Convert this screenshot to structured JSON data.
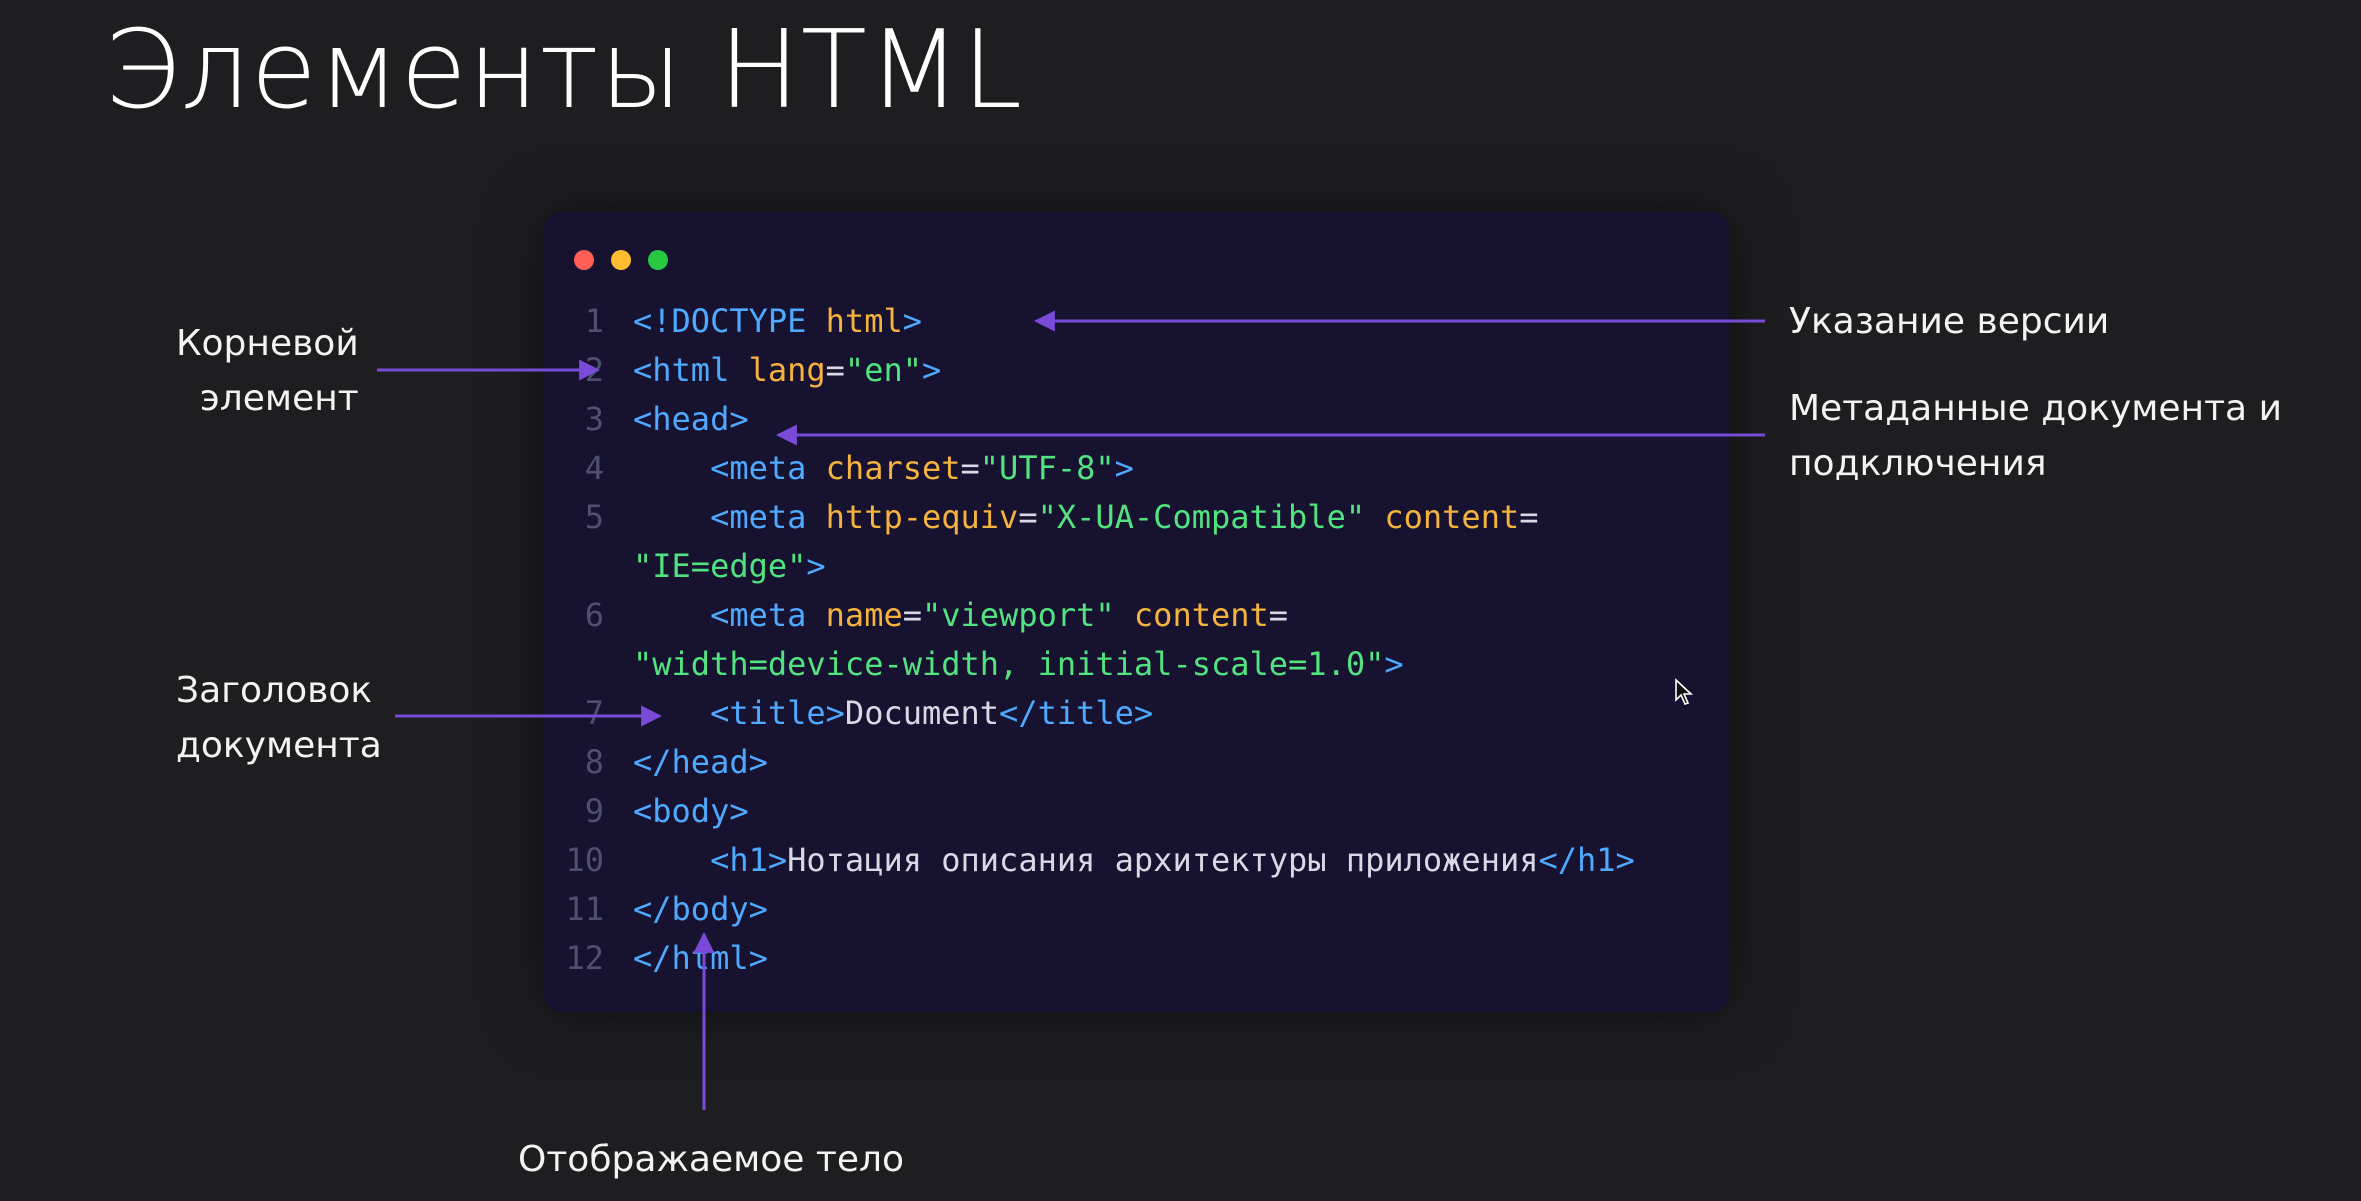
{
  "slide": {
    "title": "Элементы HTML"
  },
  "colors": {
    "background": "#1e1e21",
    "window": "#16122f",
    "tag": "#4fa9ff",
    "attribute": "#f4b23e",
    "string": "#52e27f",
    "text": "#d9d9e6",
    "line_number": "#4f4f6e",
    "arrow": "#7a4ad8",
    "dot_red": "#ff5f57",
    "dot_yellow": "#febc2e",
    "dot_green": "#28c840"
  },
  "code": {
    "lines": [
      {
        "num": "1",
        "tokens": [
          {
            "t": "tag",
            "v": "<!DOCTYPE "
          },
          {
            "t": "attr",
            "v": "html"
          },
          {
            "t": "tag",
            "v": ">"
          }
        ]
      },
      {
        "num": "2",
        "tokens": [
          {
            "t": "tag",
            "v": "<html "
          },
          {
            "t": "attr",
            "v": "lang"
          },
          {
            "t": "plain",
            "v": "="
          },
          {
            "t": "str",
            "v": "\"en\""
          },
          {
            "t": "tag",
            "v": ">"
          }
        ]
      },
      {
        "num": "3",
        "tokens": [
          {
            "t": "tag",
            "v": "<head>"
          }
        ]
      },
      {
        "num": "4",
        "tokens": [
          {
            "t": "plain",
            "v": "    "
          },
          {
            "t": "tag",
            "v": "<meta "
          },
          {
            "t": "attr",
            "v": "charset"
          },
          {
            "t": "plain",
            "v": "="
          },
          {
            "t": "str",
            "v": "\"UTF-8\""
          },
          {
            "t": "tag",
            "v": ">"
          }
        ]
      },
      {
        "num": "5",
        "tokens": [
          {
            "t": "plain",
            "v": "    "
          },
          {
            "t": "tag",
            "v": "<meta "
          },
          {
            "t": "attr",
            "v": "http-equiv"
          },
          {
            "t": "plain",
            "v": "="
          },
          {
            "t": "str",
            "v": "\"X-UA-Compatible\""
          },
          {
            "t": "plain",
            "v": " "
          },
          {
            "t": "attr",
            "v": "content"
          },
          {
            "t": "plain",
            "v": "="
          }
        ]
      },
      {
        "num": "",
        "tokens": [
          {
            "t": "str",
            "v": "\"IE=edge\""
          },
          {
            "t": "tag",
            "v": ">"
          }
        ]
      },
      {
        "num": "6",
        "tokens": [
          {
            "t": "plain",
            "v": "    "
          },
          {
            "t": "tag",
            "v": "<meta "
          },
          {
            "t": "attr",
            "v": "name"
          },
          {
            "t": "plain",
            "v": "="
          },
          {
            "t": "str",
            "v": "\"viewport\""
          },
          {
            "t": "plain",
            "v": " "
          },
          {
            "t": "attr",
            "v": "content"
          },
          {
            "t": "plain",
            "v": "="
          }
        ]
      },
      {
        "num": "",
        "tokens": [
          {
            "t": "str",
            "v": "\"width=device-width, initial-scale=1.0\""
          },
          {
            "t": "tag",
            "v": ">"
          }
        ]
      },
      {
        "num": "7",
        "tokens": [
          {
            "t": "plain",
            "v": "    "
          },
          {
            "t": "tag",
            "v": "<title>"
          },
          {
            "t": "plain",
            "v": "Document"
          },
          {
            "t": "tag",
            "v": "</title>"
          }
        ]
      },
      {
        "num": "8",
        "tokens": [
          {
            "t": "tag",
            "v": "</head>"
          }
        ]
      },
      {
        "num": "9",
        "tokens": [
          {
            "t": "tag",
            "v": "<body>"
          }
        ]
      },
      {
        "num": "10",
        "tokens": [
          {
            "t": "plain",
            "v": "    "
          },
          {
            "t": "tag",
            "v": "<h1>"
          },
          {
            "t": "plain",
            "v": "Нотация описания архитектуры приложения"
          },
          {
            "t": "tag",
            "v": "</h1>"
          }
        ]
      },
      {
        "num": "11",
        "tokens": [
          {
            "t": "tag",
            "v": "</body>"
          }
        ]
      },
      {
        "num": "12",
        "tokens": [
          {
            "t": "tag",
            "v": "</html>"
          }
        ]
      }
    ]
  },
  "annotations": {
    "root_line1": "Корневой",
    "root_line2": "элемент",
    "version": "Указание версии",
    "meta_line1": "Метаданные документа и",
    "meta_line2": "подключения",
    "doctitle_line1": "Заголовок",
    "doctitle_line2": "документа",
    "body": "Отображаемое тело"
  }
}
